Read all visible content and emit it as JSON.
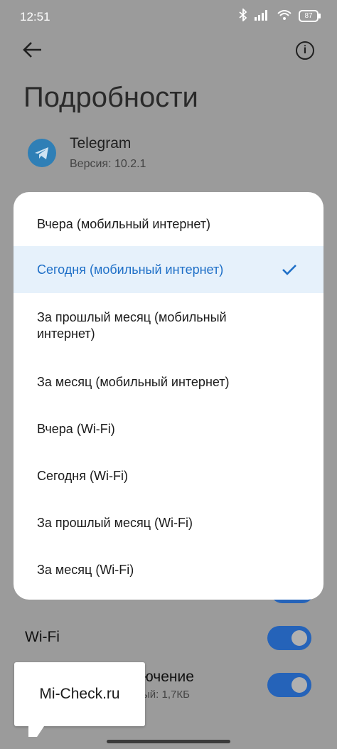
{
  "status_bar": {
    "time": "12:51",
    "battery": "87"
  },
  "header": {
    "title": "Подробности"
  },
  "app": {
    "name": "Telegram",
    "version": "Версия: 10.2.1"
  },
  "menu": {
    "items": [
      {
        "label": "Вчера (мобильный интернет)",
        "selected": false
      },
      {
        "label": "Сегодня (мобильный интернет)",
        "selected": true
      },
      {
        "label": "За прошлый месяц (мобильный интернет)",
        "selected": false
      },
      {
        "label": "За месяц (мобильный интернет)",
        "selected": false
      },
      {
        "label": "Вчера (Wi-Fi)",
        "selected": false
      },
      {
        "label": "Сегодня (Wi-Fi)",
        "selected": false
      },
      {
        "label": "За прошлый месяц (Wi-Fi)",
        "selected": false
      },
      {
        "label": "За месяц (Wi-Fi)",
        "selected": false
      }
    ]
  },
  "settings": {
    "wifi_label": "Wi-Fi",
    "row2_title_partial": "ючение",
    "row2_subtitle_partial": "ый: 1,7КБ"
  },
  "watermark": {
    "text": "Mi-Check.ru"
  },
  "colors": {
    "accent": "#1e6fc7",
    "selected_bg": "#e6f1fb",
    "toggle": "#2563b9",
    "overlay": "#9b9b9b"
  }
}
